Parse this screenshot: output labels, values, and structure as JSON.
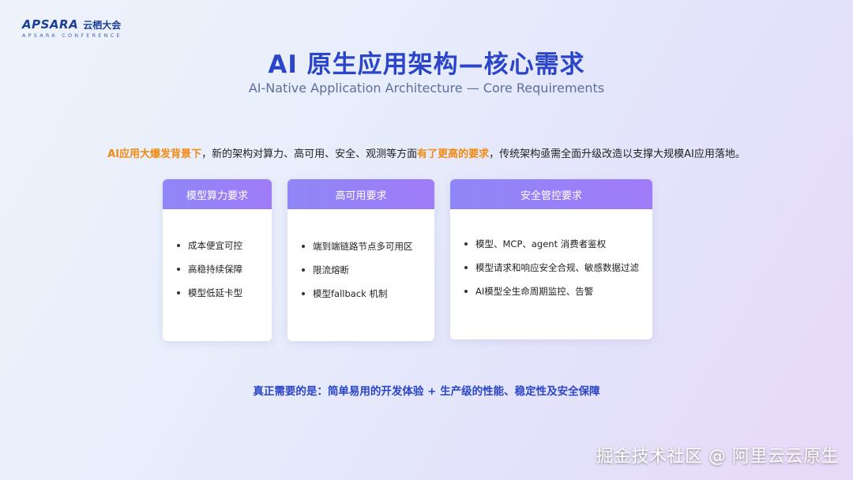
{
  "logo": {
    "word": "APSARA",
    "cn": "云栖大会",
    "sub": "APSARA CONFERENCE"
  },
  "title": "AI 原生应用架构—核心需求",
  "subtitle": "AI-Native Application Architecture — Core Requirements",
  "intro": {
    "part1": "AI应用大爆发背景下",
    "part2": "，新的架构对算力、高可用、安全、观测等方面",
    "part3": "有了更高的要求",
    "part4": "，传统架构亟需全面升级改造以支撑大规模AI应用落地。"
  },
  "cards": [
    {
      "title": "模型算力要求",
      "items": [
        "成本便宜可控",
        "高稳持续保障",
        "模型低延卡型"
      ]
    },
    {
      "title": "高可用要求",
      "items": [
        "端到端链路节点多可用区",
        "限流熔断",
        "模型fallback 机制"
      ]
    },
    {
      "title": "安全管控要求",
      "items": [
        "模型、MCP、agent 消费者鉴权",
        "模型请求和响应安全合规、敏感数据过滤",
        "AI模型全生命周期监控、告警"
      ]
    }
  ],
  "summary": "真正需要的是：简单易用的开发体验 + 生产级的性能、稳定性及安全保障",
  "watermark": "掘金技术社区 @ 阿里云云原生",
  "colors": {
    "title": "#2a45c8",
    "highlight": "#f08a14",
    "card_header": "#9b80f8"
  }
}
